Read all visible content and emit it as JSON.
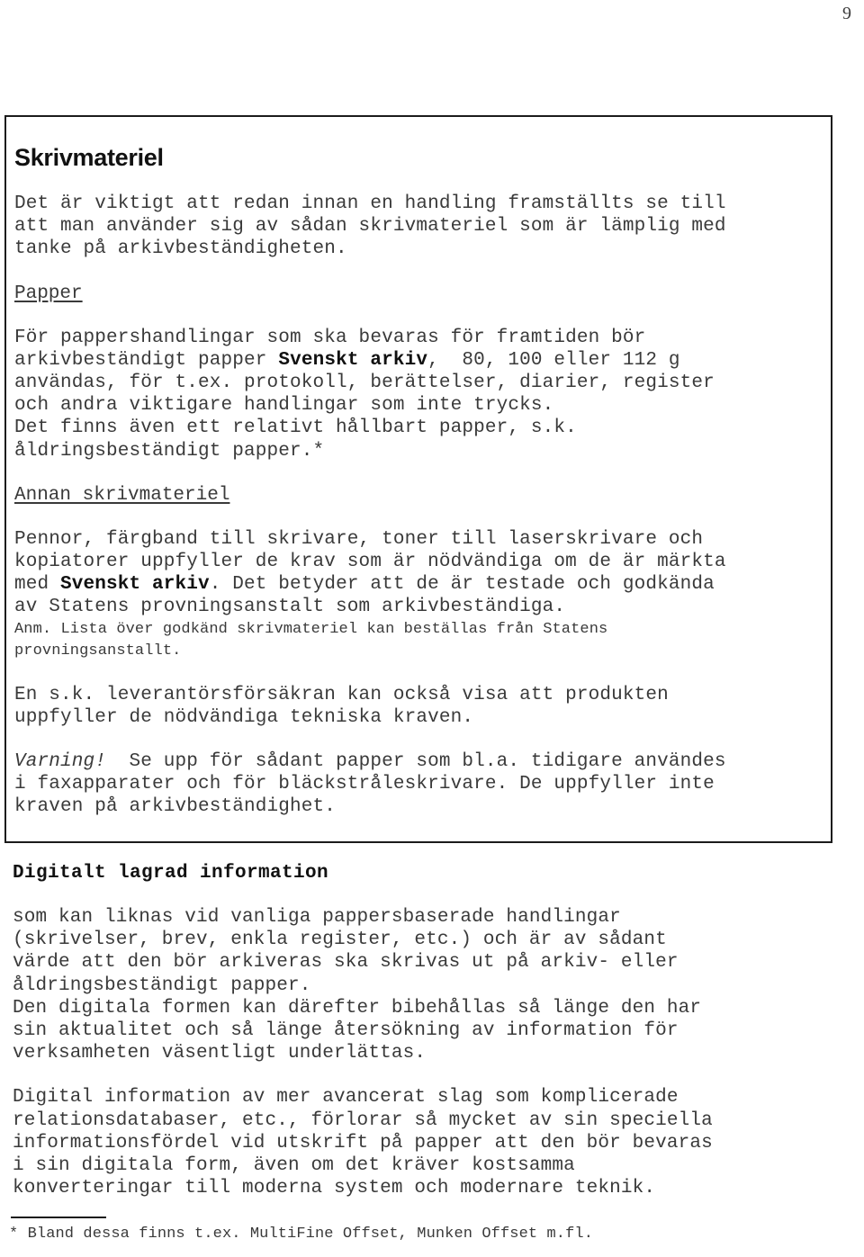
{
  "page": {
    "number": "9"
  },
  "boxed_section": {
    "heading": "Skrivmateriel",
    "intro_paragraph": "Det är viktigt att redan innan en handling framställts se till\natt man använder sig av sådan skrivmateriel som är lämplig med\ntanke på arkivbeständigheten.",
    "papper": {
      "heading": "Papper",
      "line1": "För pappershandlingar som ska bevaras för framtiden bör",
      "line2_pre": "arkivbeständigt papper ",
      "line2_bold": "Svenskt arkiv",
      "line2_post": ",  80, 100 eller 112 g",
      "rest": "användas, för t.ex. protokoll, berättelser, diarier, register\noch andra viktigare handlingar som inte trycks.\nDet finns även ett relativt hållbart papper, s.k.\nåldringsbeständigt papper.*"
    },
    "annan_skrivmateriel": {
      "heading": "Annan skrivmateriel",
      "line1": "Pennor, färgband till skrivare, toner till laserskrivare och\nkopiatorer uppfyller de krav som är nödvändiga om de är märkta\nmed ",
      "bold_term": "Svenskt arkiv",
      "line2": ". Det betyder att de är testade och godkända\nav Statens provningsanstalt som arkivbeständiga.",
      "note": "Anm. Lista över godkänd skrivmateriel kan beställas från Statens\nprovningsanstallt."
    },
    "leverantor_paragraph": "En s.k. leverantörsförsäkran kan också visa att produkten\nuppfyller de nödvändiga tekniska kraven.",
    "varning": {
      "label": "Varning!",
      "text": "  Se upp för sådant papper som bl.a. tidigare användes\ni faxapparater och för bläckstråleskrivare. De uppfyller inte\nkraven på arkivbeständighet."
    }
  },
  "digital_section": {
    "heading": "Digitalt lagrad information",
    "paragraph1": "som kan liknas vid vanliga pappersbaserade handlingar\n(skrivelser, brev, enkla register, etc.) och är av sådant\nvärde att den bör arkiveras ska skrivas ut på arkiv- eller\nåldringsbeständigt papper.\nDen digitala formen kan därefter bibehållas så länge den har\nsin aktualitet och så länge återsökning av information för\nverksamheten väsentligt underlättas.",
    "paragraph2": "Digital information av mer avancerat slag som komplicerade\nrelationsdatabaser, etc., förlorar så mycket av sin speciella\ninformationsfördel vid utskrift på papper att den bör bevaras\ni sin digitala form, även om det kräver kostsamma\nkonverteringar till moderna system och modernare teknik."
  },
  "footnote": {
    "text": "* Bland dessa finns t.ex. MultiFine Offset, Munken Offset m.fl."
  },
  "colors": {
    "text": "#3a3a3a",
    "heading": "#111111",
    "border": "#1b1b1b",
    "background": "#ffffff"
  }
}
